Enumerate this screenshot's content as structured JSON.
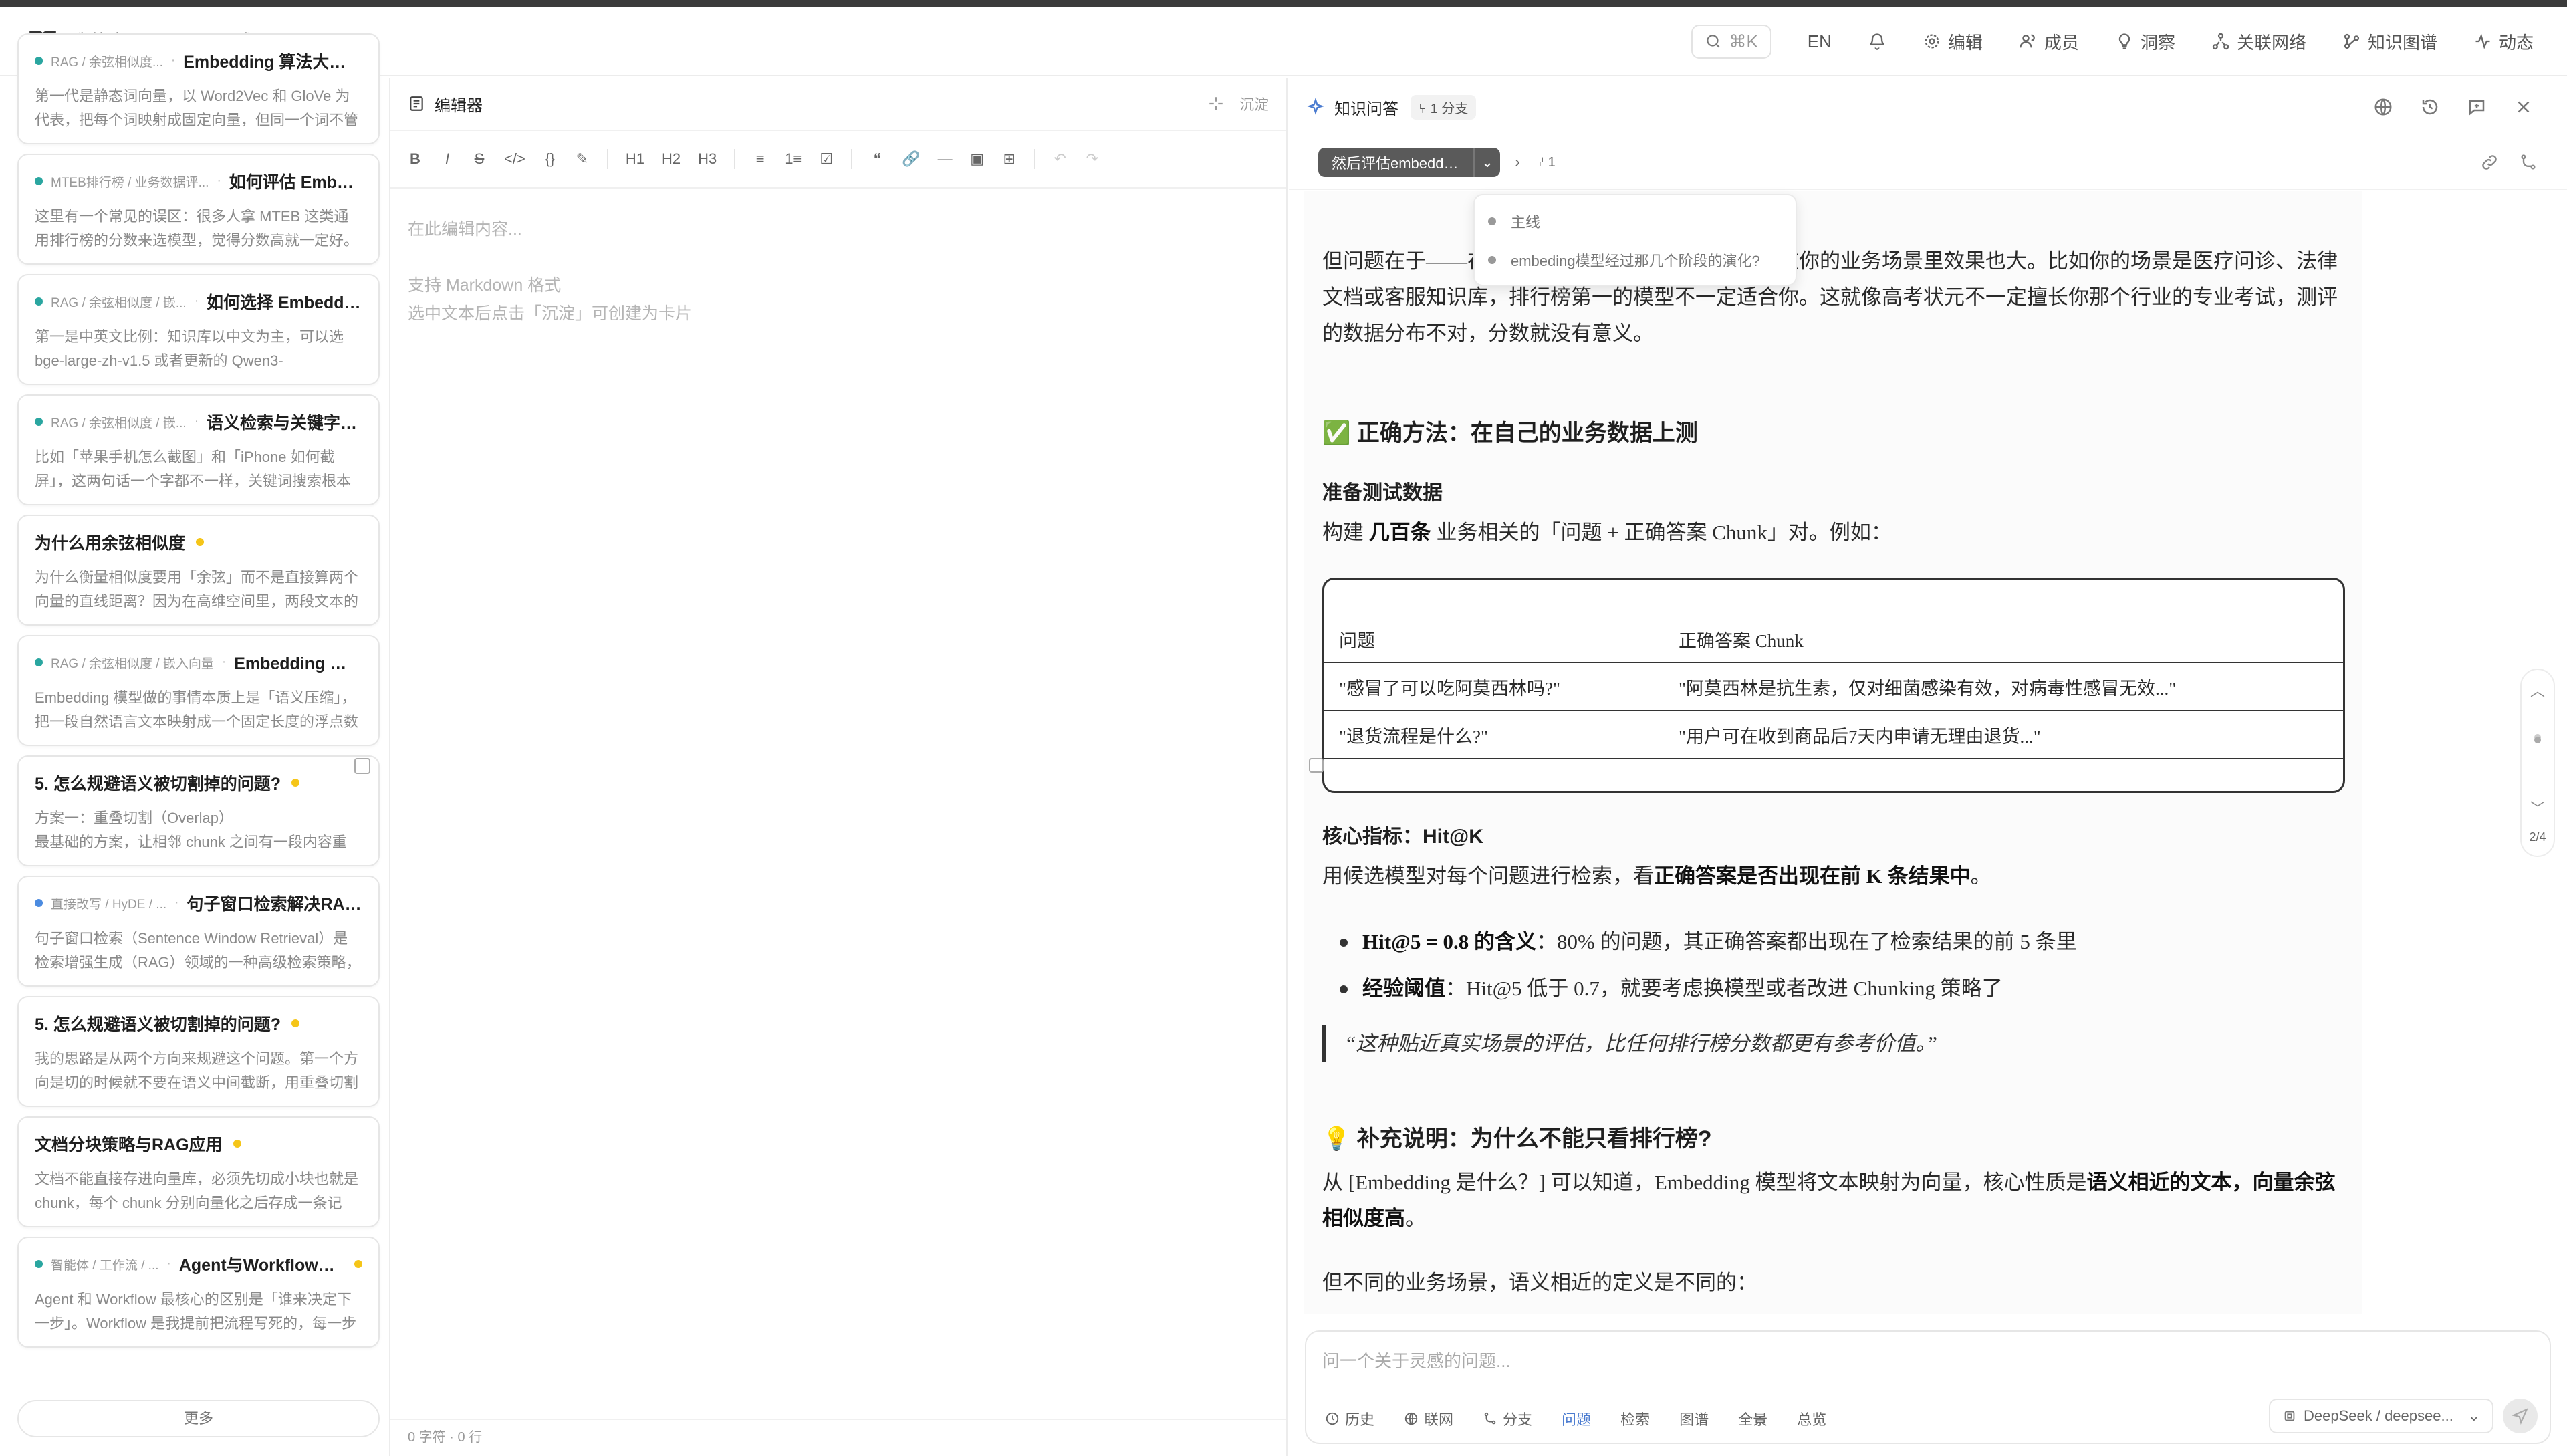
{
  "header": {
    "breadcrumb_root": "我的空间",
    "breadcrumb_sep": "/",
    "breadcrumb_current": "agent面试",
    "search_shortcut": "⌘K",
    "lang": "EN",
    "nav": [
      "编辑",
      "成员",
      "洞察",
      "关联网络",
      "知识图谱",
      "动态"
    ]
  },
  "cards": [
    {
      "crumb": "RAG / 余弦相似度...",
      "title": "Embedding 算法大致经历了...",
      "body": "第一代是静态词向量，以 Word2Vec 和 GloVe 为代表，把每个词映射成固定向量，但同一个词不管上...",
      "dot": "teal",
      "tdot": false
    },
    {
      "crumb": "MTEB排行榜 / 业务数据评...",
      "title": "如何评估 Embedding...",
      "body": "这里有一个常见的误区：很多人拿 MTEB 这类通用排行榜的分数来选模型，觉得分数高就一定好。MTE...",
      "dot": "teal",
      "tdot": false
    },
    {
      "crumb": "RAG / 余弦相似度 / 嵌...",
      "title": "如何选择 Embedding ...",
      "body": "第一是中英文比例：知识库以中文为主，可以选 bge-large-zh-v1.5 或者更新的 Qwen3-Embedding；中...",
      "dot": "teal",
      "tdot": false
    },
    {
      "crumb": "RAG / 余弦相似度 / 嵌...",
      "title": "语义检索与关键字搜索...",
      "body": "比如「苹果手机怎么截图」和「iPhone 如何截屏」，这两句话一个字都不一样，关键词搜索根本匹配不...",
      "dot": "teal",
      "tdot": false
    },
    {
      "crumb": "",
      "title": "为什么用余弦相似度",
      "body": "为什么衡量相似度要用「余弦」而不是直接算两个向量的直线距离？因为在高维空间里，两段文本的向...",
      "dot": "",
      "tdot": true
    },
    {
      "crumb": "RAG / 余弦相似度 / 嵌入向量",
      "title": "Embedding 是什么?",
      "body": "Embedding 模型做的事情本质上是「语义压缩」，把一段自然语言文本映射成一个固定长度的浮点数向...",
      "dot": "teal",
      "tdot": false
    },
    {
      "crumb": "",
      "title": "5. 怎么规避语义被切割掉的问题?",
      "body": "方案一：重叠切割（Overlap）\n最基础的方案，让相邻 chunk 之间有一段内容重叠...",
      "dot": "",
      "tdot": true
    },
    {
      "crumb": "直接改写 / HyDE / ...",
      "title": "句子窗口检索解决RAG...",
      "body": "句子窗口检索（Sentence Window Retrieval）是检索增强生成（RAG）领域的一种高级检索策略，旨在...",
      "dot": "blue",
      "tdot": false
    },
    {
      "crumb": "",
      "title": "5. 怎么规避语义被切割掉的问题?",
      "body": "我的思路是从两个方向来规避这个问题。第一个方向是切的时候就不要在语义中间截断，用重叠切割和...",
      "dot": "",
      "tdot": true
    },
    {
      "crumb": "",
      "title": "文档分块策略与RAG应用",
      "body": "文档不能直接存进向量库，必须先切成小块也就是 chunk，每个 chunk 分别向量化之后存成一条记录...",
      "dot": "",
      "tdot": true
    },
    {
      "crumb": "智能体 / 工作流 / ...",
      "title": "Agent与Workflow的混...",
      "body": "Agent 和 Workflow 最核心的区别是「谁来决定下一步」。Workflow 是我提前把流程写死的，每一步怎...",
      "dot": "teal",
      "tdot": true
    }
  ],
  "more_label": "更多",
  "editor": {
    "title": "编辑器",
    "sink_label": "沉淀",
    "tools": [
      "B",
      "I",
      "S",
      "</>",
      "{}",
      "✎",
      "H1",
      "H2",
      "H3",
      "≡",
      "1≡",
      "☑",
      "❝",
      "🔗",
      "—",
      "▣",
      "⊞",
      "↶",
      "↷"
    ],
    "placeholder": "在此编辑内容...",
    "hint1": "支持 Markdown 格式",
    "hint2": "选中文本后点击「沉淀」可创建为卡片",
    "status": "0 字符 · 0 行"
  },
  "qa": {
    "title": "知识问答",
    "branch_tag": "1 分支",
    "branch_selected": "然后评估embedding模型",
    "branch_count": "1",
    "dropdown": [
      "主线",
      "embeding模型经过那几个阶段的演化?"
    ],
    "input_placeholder": "问一个关于灵感的问题...",
    "tools": [
      "历史",
      "联网",
      "分支",
      "问题",
      "检索",
      "图谱",
      "全景",
      "总览"
    ],
    "model": "DeepSeek / deepsee...",
    "page_indicator": "2/4"
  },
  "doc": {
    "p_intro": "但问题在于——在通用数据集上分数高，并不代表在你的业务场景里效果也大。比如你的场景是医疗问诊、法律文档或客服知识库，排行榜第一的模型不一定适合你。这就像高考状元不一定擅长你那个行业的专业考试，测评的数据分布不对，分数就没有意义。",
    "h_correct": "✅ 正确方法：在自己的业务数据上测",
    "h_prepare": "准备测试数据",
    "p_prepare_a": "构建",
    "p_prepare_em": "几百条",
    "p_prepare_b": "业务相关的「问题 + 正确答案 Chunk」对。例如：",
    "table_head": [
      "问题",
      "正确答案 Chunk"
    ],
    "table_rows": [
      [
        "\"感冒了可以吃阿莫西林吗?\"",
        "\"阿莫西林是抗生素，仅对细菌感染有效，对病毒性感冒无效...\""
      ],
      [
        "\"退货流程是什么?\"",
        "\"用户可在收到商品后7天内申请无理由退货...\""
      ]
    ],
    "h_metric": "核心指标：Hit@K",
    "p_metric_a": "用候选模型对每个问题进行检索，看",
    "p_metric_em": "正确答案是否出现在前 K 条结果中",
    "p_metric_b": "。",
    "li1_em": "Hit@5 = 0.8 的含义",
    "li1_rest": "：80% 的问题，其正确答案都出现在了检索结果的前 5 条里",
    "li2_em": "经验阈值",
    "li2_rest": "：Hit@5 低于 0.7，就要考虑换模型或者改进 Chunking 策略了",
    "quote": "“这种贴近真实场景的评估，比任何排行榜分数都更有参考价值。”",
    "h_supp": "💡 补充说明：为什么不能只看排行榜?",
    "p_supp_a": "从 [Embedding 是什么？] 可以知道，Embedding 模型将文本映射为向量，核心性质是",
    "p_supp_em": "语义相近的文本，向量余弦相似度高",
    "p_supp_b": "。",
    "p_last": "但不同的业务场景，语义相近的定义是不同的："
  }
}
